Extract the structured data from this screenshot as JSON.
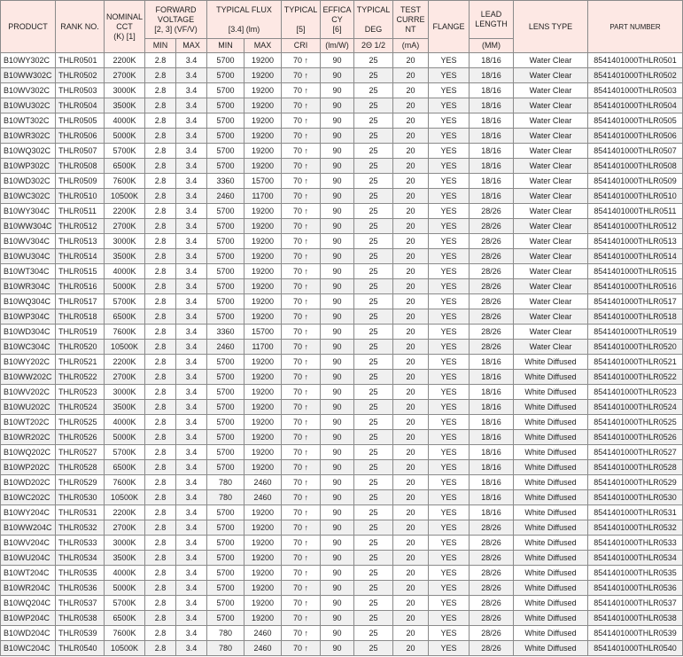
{
  "header": {
    "product": "PRODUCT",
    "rank_no": "RANK NO.",
    "cct_lines": [
      "NOMINAL",
      "CCT",
      "(K)   [1]"
    ],
    "fv_lines": [
      "FORWARD",
      "VOLTAGE"
    ],
    "fv_sub": "[2, 3] (VF/V)",
    "flux": "TYPICAL FLUX",
    "flux_sub": "[3.4] (lm)",
    "cri": "TYPICAL",
    "cri_sub": "[5]",
    "eff_lines": [
      "EFFICA",
      "CY"
    ],
    "eff_sub": "[6]",
    "typical": "TYPICAL",
    "typical_sub": "DEG",
    "test_lines": [
      "TEST",
      "CURRE",
      "NT"
    ],
    "flange": "FLANGE",
    "lead_lines": [
      "LEAD",
      "LENGTH"
    ],
    "lens": "LENS TYPE",
    "part": "PART NUMBER",
    "sub": {
      "min": "MIN",
      "max": "MAX",
      "flux_min": "MIN",
      "flux_max": "MAX",
      "cri": "CRI",
      "eff": "(lm/W)",
      "deg": "2Θ 1/2",
      "test": "(mA)",
      "lead": "(MM)"
    }
  },
  "rows": [
    [
      "B10WY302C",
      "THLR0501",
      "2200K",
      "2.8",
      "3.4",
      "5700",
      "19200",
      "70 ↑",
      "90",
      "25",
      "20",
      "YES",
      "18/16",
      "Water Clear",
      "8541401000THLR0501"
    ],
    [
      "B10WW302C",
      "THLR0502",
      "2700K",
      "2.8",
      "3.4",
      "5700",
      "19200",
      "70 ↑",
      "90",
      "25",
      "20",
      "YES",
      "18/16",
      "Water Clear",
      "8541401000THLR0502"
    ],
    [
      "B10WV302C",
      "THLR0503",
      "3000K",
      "2.8",
      "3.4",
      "5700",
      "19200",
      "70 ↑",
      "90",
      "25",
      "20",
      "YES",
      "18/16",
      "Water Clear",
      "8541401000THLR0503"
    ],
    [
      "B10WU302C",
      "THLR0504",
      "3500K",
      "2.8",
      "3.4",
      "5700",
      "19200",
      "70 ↑",
      "90",
      "25",
      "20",
      "YES",
      "18/16",
      "Water Clear",
      "8541401000THLR0504"
    ],
    [
      "B10WT302C",
      "THLR0505",
      "4000K",
      "2.8",
      "3.4",
      "5700",
      "19200",
      "70 ↑",
      "90",
      "25",
      "20",
      "YES",
      "18/16",
      "Water Clear",
      "8541401000THLR0505"
    ],
    [
      "B10WR302C",
      "THLR0506",
      "5000K",
      "2.8",
      "3.4",
      "5700",
      "19200",
      "70 ↑",
      "90",
      "25",
      "20",
      "YES",
      "18/16",
      "Water Clear",
      "8541401000THLR0506"
    ],
    [
      "B10WQ302C",
      "THLR0507",
      "5700K",
      "2.8",
      "3.4",
      "5700",
      "19200",
      "70 ↑",
      "90",
      "25",
      "20",
      "YES",
      "18/16",
      "Water Clear",
      "8541401000THLR0507"
    ],
    [
      "B10WP302C",
      "THLR0508",
      "6500K",
      "2.8",
      "3.4",
      "5700",
      "19200",
      "70 ↑",
      "90",
      "25",
      "20",
      "YES",
      "18/16",
      "Water Clear",
      "8541401000THLR0508"
    ],
    [
      "B10WD302C",
      "THLR0509",
      "7600K",
      "2.8",
      "3.4",
      "3360",
      "15700",
      "70 ↑",
      "90",
      "25",
      "20",
      "YES",
      "18/16",
      "Water Clear",
      "8541401000THLR0509"
    ],
    [
      "B10WC302C",
      "THLR0510",
      "10500K",
      "2.8",
      "3.4",
      "2460",
      "11700",
      "70 ↑",
      "90",
      "25",
      "20",
      "YES",
      "18/16",
      "Water Clear",
      "8541401000THLR0510"
    ],
    [
      "B10WY304C",
      "THLR0511",
      "2200K",
      "2.8",
      "3.4",
      "5700",
      "19200",
      "70 ↑",
      "90",
      "25",
      "20",
      "YES",
      "28/26",
      "Water Clear",
      "8541401000THLR0511"
    ],
    [
      "B10WW304C",
      "THLR0512",
      "2700K",
      "2.8",
      "3.4",
      "5700",
      "19200",
      "70 ↑",
      "90",
      "25",
      "20",
      "YES",
      "28/26",
      "Water Clear",
      "8541401000THLR0512"
    ],
    [
      "B10WV304C",
      "THLR0513",
      "3000K",
      "2.8",
      "3.4",
      "5700",
      "19200",
      "70 ↑",
      "90",
      "25",
      "20",
      "YES",
      "28/26",
      "Water Clear",
      "8541401000THLR0513"
    ],
    [
      "B10WU304C",
      "THLR0514",
      "3500K",
      "2.8",
      "3.4",
      "5700",
      "19200",
      "70 ↑",
      "90",
      "25",
      "20",
      "YES",
      "28/26",
      "Water Clear",
      "8541401000THLR0514"
    ],
    [
      "B10WT304C",
      "THLR0515",
      "4000K",
      "2.8",
      "3.4",
      "5700",
      "19200",
      "70 ↑",
      "90",
      "25",
      "20",
      "YES",
      "28/26",
      "Water Clear",
      "8541401000THLR0515"
    ],
    [
      "B10WR304C",
      "THLR0516",
      "5000K",
      "2.8",
      "3.4",
      "5700",
      "19200",
      "70 ↑",
      "90",
      "25",
      "20",
      "YES",
      "28/26",
      "Water Clear",
      "8541401000THLR0516"
    ],
    [
      "B10WQ304C",
      "THLR0517",
      "5700K",
      "2.8",
      "3.4",
      "5700",
      "19200",
      "70 ↑",
      "90",
      "25",
      "20",
      "YES",
      "28/26",
      "Water Clear",
      "8541401000THLR0517"
    ],
    [
      "B10WP304C",
      "THLR0518",
      "6500K",
      "2.8",
      "3.4",
      "5700",
      "19200",
      "70 ↑",
      "90",
      "25",
      "20",
      "YES",
      "28/26",
      "Water Clear",
      "8541401000THLR0518"
    ],
    [
      "B10WD304C",
      "THLR0519",
      "7600K",
      "2.8",
      "3.4",
      "3360",
      "15700",
      "70 ↑",
      "90",
      "25",
      "20",
      "YES",
      "28/26",
      "Water Clear",
      "8541401000THLR0519"
    ],
    [
      "B10WC304C",
      "THLR0520",
      "10500K",
      "2.8",
      "3.4",
      "2460",
      "11700",
      "70 ↑",
      "90",
      "25",
      "20",
      "YES",
      "28/26",
      "Water Clear",
      "8541401000THLR0520"
    ],
    [
      "B10WY202C",
      "THLR0521",
      "2200K",
      "2.8",
      "3.4",
      "5700",
      "19200",
      "70 ↑",
      "90",
      "25",
      "20",
      "YES",
      "18/16",
      "White Diffused",
      "8541401000THLR0521"
    ],
    [
      "B10WW202C",
      "THLR0522",
      "2700K",
      "2.8",
      "3.4",
      "5700",
      "19200",
      "70 ↑",
      "90",
      "25",
      "20",
      "YES",
      "18/16",
      "White Diffused",
      "8541401000THLR0522"
    ],
    [
      "B10WV202C",
      "THLR0523",
      "3000K",
      "2.8",
      "3.4",
      "5700",
      "19200",
      "70 ↑",
      "90",
      "25",
      "20",
      "YES",
      "18/16",
      "White Diffused",
      "8541401000THLR0523"
    ],
    [
      "B10WU202C",
      "THLR0524",
      "3500K",
      "2.8",
      "3.4",
      "5700",
      "19200",
      "70 ↑",
      "90",
      "25",
      "20",
      "YES",
      "18/16",
      "White Diffused",
      "8541401000THLR0524"
    ],
    [
      "B10WT202C",
      "THLR0525",
      "4000K",
      "2.8",
      "3.4",
      "5700",
      "19200",
      "70 ↑",
      "90",
      "25",
      "20",
      "YES",
      "18/16",
      "White Diffused",
      "8541401000THLR0525"
    ],
    [
      "B10WR202C",
      "THLR0526",
      "5000K",
      "2.8",
      "3.4",
      "5700",
      "19200",
      "70 ↑",
      "90",
      "25",
      "20",
      "YES",
      "18/16",
      "White Diffused",
      "8541401000THLR0526"
    ],
    [
      "B10WQ202C",
      "THLR0527",
      "5700K",
      "2.8",
      "3.4",
      "5700",
      "19200",
      "70 ↑",
      "90",
      "25",
      "20",
      "YES",
      "18/16",
      "White Diffused",
      "8541401000THLR0527"
    ],
    [
      "B10WP202C",
      "THLR0528",
      "6500K",
      "2.8",
      "3.4",
      "5700",
      "19200",
      "70 ↑",
      "90",
      "25",
      "20",
      "YES",
      "18/16",
      "White Diffused",
      "8541401000THLR0528"
    ],
    [
      "B10WD202C",
      "THLR0529",
      "7600K",
      "2.8",
      "3.4",
      "780",
      "2460",
      "70 ↑",
      "90",
      "25",
      "20",
      "YES",
      "18/16",
      "White Diffused",
      "8541401000THLR0529"
    ],
    [
      "B10WC202C",
      "THLR0530",
      "10500K",
      "2.8",
      "3.4",
      "780",
      "2460",
      "70 ↑",
      "90",
      "25",
      "20",
      "YES",
      "18/16",
      "White Diffused",
      "8541401000THLR0530"
    ],
    [
      "B10WY204C",
      "THLR0531",
      "2200K",
      "2.8",
      "3.4",
      "5700",
      "19200",
      "70 ↑",
      "90",
      "25",
      "20",
      "YES",
      "18/16",
      "White Diffused",
      "8541401000THLR0531"
    ],
    [
      "B10WW204C",
      "THLR0532",
      "2700K",
      "2.8",
      "3.4",
      "5700",
      "19200",
      "70 ↑",
      "90",
      "25",
      "20",
      "YES",
      "28/26",
      "White Diffused",
      "8541401000THLR0532"
    ],
    [
      "B10WV204C",
      "THLR0533",
      "3000K",
      "2.8",
      "3.4",
      "5700",
      "19200",
      "70 ↑",
      "90",
      "25",
      "20",
      "YES",
      "28/26",
      "White Diffused",
      "8541401000THLR0533"
    ],
    [
      "B10WU204C",
      "THLR0534",
      "3500K",
      "2.8",
      "3.4",
      "5700",
      "19200",
      "70 ↑",
      "90",
      "25",
      "20",
      "YES",
      "28/26",
      "White Diffused",
      "8541401000THLR0534"
    ],
    [
      "B10WT204C",
      "THLR0535",
      "4000K",
      "2.8",
      "3.4",
      "5700",
      "19200",
      "70 ↑",
      "90",
      "25",
      "20",
      "YES",
      "28/26",
      "White Diffused",
      "8541401000THLR0535"
    ],
    [
      "B10WR204C",
      "THLR0536",
      "5000K",
      "2.8",
      "3.4",
      "5700",
      "19200",
      "70 ↑",
      "90",
      "25",
      "20",
      "YES",
      "28/26",
      "White Diffused",
      "8541401000THLR0536"
    ],
    [
      "B10WQ204C",
      "THLR0537",
      "5700K",
      "2.8",
      "3.4",
      "5700",
      "19200",
      "70 ↑",
      "90",
      "25",
      "20",
      "YES",
      "28/26",
      "White Diffused",
      "8541401000THLR0537"
    ],
    [
      "B10WP204C",
      "THLR0538",
      "6500K",
      "2.8",
      "3.4",
      "5700",
      "19200",
      "70 ↑",
      "90",
      "25",
      "20",
      "YES",
      "28/26",
      "White Diffused",
      "8541401000THLR0538"
    ],
    [
      "B10WD204C",
      "THLR0539",
      "7600K",
      "2.8",
      "3.4",
      "780",
      "2460",
      "70 ↑",
      "90",
      "25",
      "20",
      "YES",
      "28/26",
      "White Diffused",
      "8541401000THLR0539"
    ],
    [
      "B10WC204C",
      "THLR0540",
      "10500K",
      "2.8",
      "3.4",
      "780",
      "2460",
      "70 ↑",
      "90",
      "25",
      "20",
      "YES",
      "28/26",
      "White Diffused",
      "8541401000THLR0540"
    ]
  ],
  "colors": {
    "header_bg": "#fde8e4",
    "row_even_bg": "#f0f0f0",
    "border": "#8a8a8a"
  }
}
